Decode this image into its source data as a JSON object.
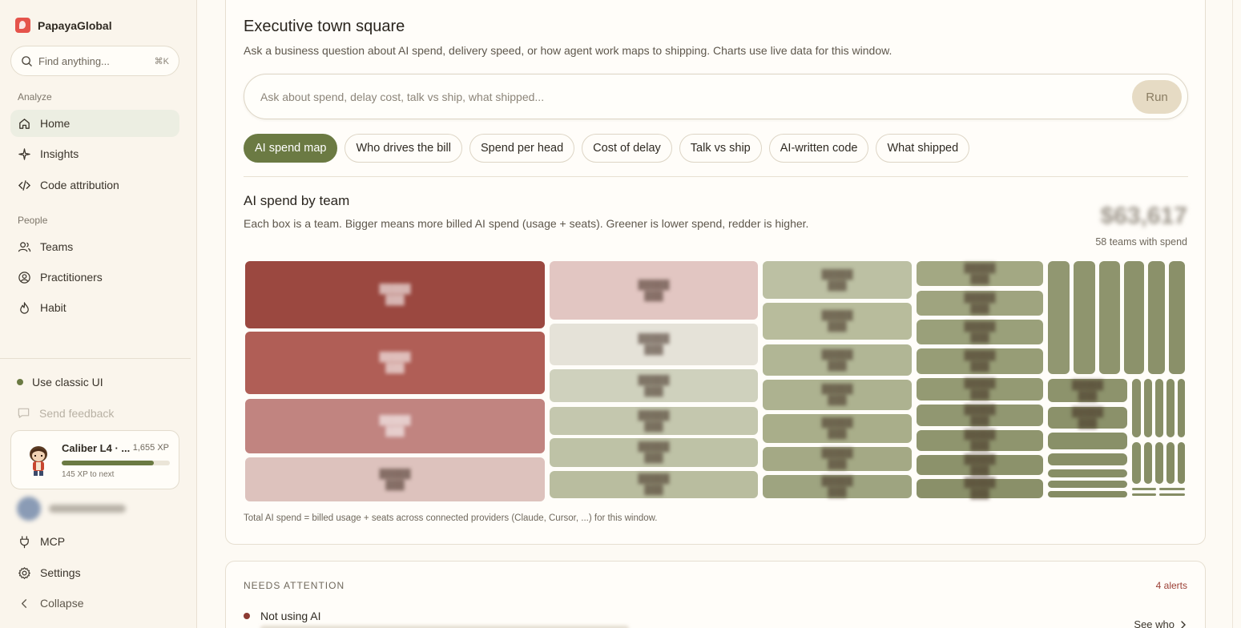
{
  "sidebar": {
    "brand": "PapayaGlobal",
    "search": {
      "placeholder": "Find anything...",
      "shortcut": "⌘K"
    },
    "section_analyze": "Analyze",
    "section_people": "People",
    "items": [
      {
        "label": "Home",
        "icon": "home-icon",
        "active": true
      },
      {
        "label": "Insights",
        "icon": "sparkle-icon"
      },
      {
        "label": "Code attribution",
        "icon": "code-icon"
      },
      {
        "label": "Teams",
        "icon": "users-icon"
      },
      {
        "label": "Practitioners",
        "icon": "user-circle-icon"
      },
      {
        "label": "Habit",
        "icon": "flame-icon"
      }
    ],
    "classic_ui": "Use classic UI",
    "send_feedback": "Send feedback",
    "caliber": {
      "title": "Caliber L4 · ...",
      "xp": "1,655 XP",
      "progress": 0.85,
      "next": "145 XP to next"
    },
    "bottom": [
      {
        "label": "MCP",
        "icon": "plug-icon"
      },
      {
        "label": "Settings",
        "icon": "gear-icon"
      },
      {
        "label": "Collapse",
        "icon": "chevron-left-icon"
      }
    ]
  },
  "main": {
    "title": "Executive town square",
    "subtitle": "Ask a business question about AI spend, delivery speed, or how agent work maps to shipping. Charts use live data for this window.",
    "ask_placeholder": "Ask about spend, delay cost, talk vs ship, what shipped...",
    "run_label": "Run",
    "chips": [
      "AI spend map",
      "Who drives the bill",
      "Spend per head",
      "Cost of delay",
      "Talk vs ship",
      "AI-written code",
      "What shipped"
    ],
    "active_chip": 0,
    "section_title": "AI spend by team",
    "section_desc": "Each box is a team. Bigger means more billed AI spend (usage + seats). Greener is lower spend, redder is higher.",
    "total_value": "$63,617",
    "teams_with_spend": "58 teams with spend",
    "footnote": "Total AI spend = billed usage + seats across connected providers (Claude, Cursor, ...) for this window."
  },
  "chart_data": {
    "type": "treemap",
    "title": "AI spend by team",
    "color_scale": {
      "low": "#8f9a68",
      "mid": "#e6e2d6",
      "high": "#9b4840"
    },
    "note": "Team names and amounts are blurred in the screenshot; only tile colors are visible."
  },
  "attention": {
    "label": "NEEDS ATTENTION",
    "count": "4 alerts",
    "first_item": "Not using AI",
    "see_who": "See who"
  },
  "colors": {
    "accent": "#6b7a43",
    "alert": "#9b3f35"
  }
}
